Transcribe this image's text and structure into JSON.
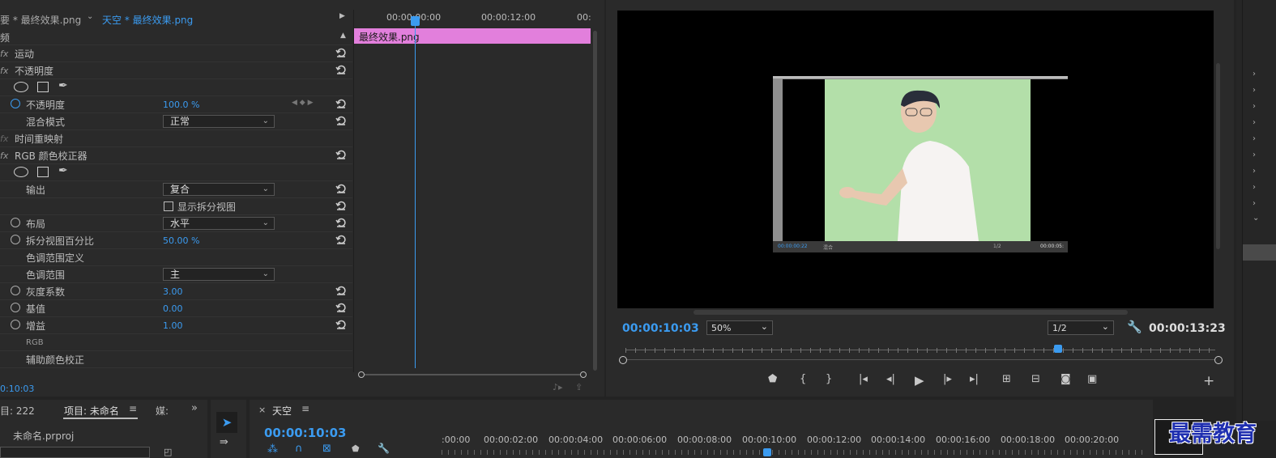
{
  "effect_controls": {
    "tab_inactive": "要 * 最终效果.png",
    "tab_active": "天空 * 最终效果.png",
    "section_title": "频",
    "timecodes": [
      "00:00:00:00",
      "00:00:12:00",
      "00:"
    ],
    "clip_name": "最终效果.png",
    "rows": [
      {
        "fx": "fx",
        "label": "运动"
      },
      {
        "fx": "fx",
        "label": "不透明度"
      },
      {
        "label": "不透明度",
        "value": "100.0 %"
      },
      {
        "label": "混合模式",
        "select": "正常"
      },
      {
        "fx": "fx",
        "label": "时间重映射"
      },
      {
        "fx": "fx",
        "label": "RGB 颜色校正器"
      },
      {
        "label": "输出",
        "select": "复合"
      },
      {
        "checkbox": "显示拆分视图"
      },
      {
        "label": "布局",
        "select": "水平"
      },
      {
        "label": "拆分视图百分比",
        "value": "50.00 %"
      },
      {
        "label": "色调范围定义"
      },
      {
        "label": "色调范围",
        "select": "主"
      },
      {
        "label": "灰度系数",
        "value": "3.00"
      },
      {
        "label": "基值",
        "value": "0.00"
      },
      {
        "label": "增益",
        "value": "1.00"
      },
      {
        "label": "RGB"
      },
      {
        "label": "辅助颜色校正"
      }
    ],
    "current_time": "0:10:03"
  },
  "program_monitor": {
    "timecode": "00:00:10:03",
    "zoom": "50%",
    "resolution": "1/2",
    "duration": "00:00:13:23",
    "inner_timecode": "00:00:00:22",
    "inner_blend": "混合",
    "inner_res": "1/2",
    "inner_duration": "00:00:05:"
  },
  "project_panel": {
    "tab_left": "目: 222",
    "tab_project": "项目: 未命名",
    "tab_media": "媒:",
    "file": "未命名.prproj"
  },
  "timeline": {
    "tab": "天空",
    "timecode": "00:00:10:03",
    "ruler": [
      ":00:00",
      "00:00:02:00",
      "00:00:04:00",
      "00:00:06:00",
      "00:00:08:00",
      "00:00:10:00",
      "00:00:12:00",
      "00:00:14:00",
      "00:00:16:00",
      "00:00:18:00",
      "00:00:20:00"
    ]
  },
  "watermark": "最需教育",
  "colors": {
    "accent": "#3b9bf0",
    "clip": "#e27fdc",
    "green_screen": "#b3dfa9"
  }
}
